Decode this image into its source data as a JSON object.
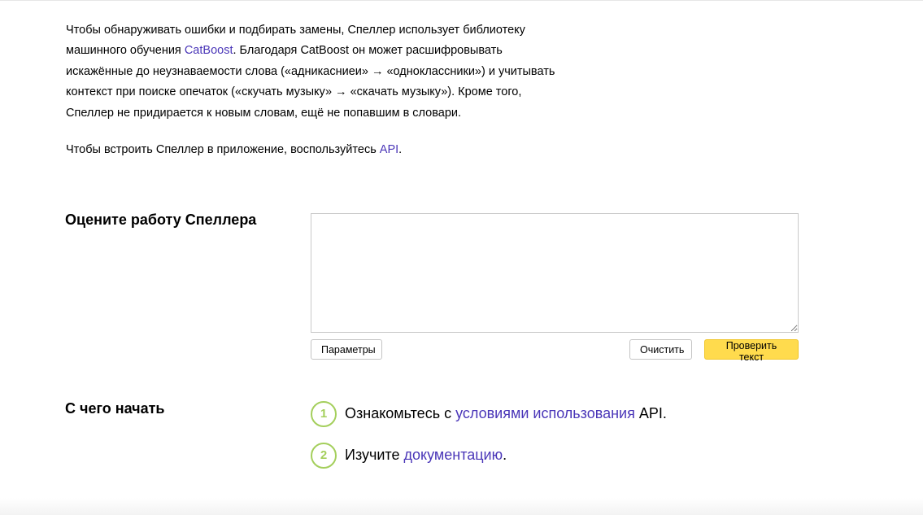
{
  "intro": {
    "p1_part1": "Чтобы обнаруживать ошибки и подбирать замены, Спеллер использует библиотеку машинного обучения ",
    "p1_link": "CatBoost",
    "p1_part2": ". Благодаря CatBoost он может расшифровывать искажённые до неузнаваемости слова («адникасниеи» → «одноклассники») и учитывать контекст при поиске опечаток («скучать музыку» → «скачать музыку»). Кроме того, Спеллер не придирается к новым словам, ещё не попавшим в словари.",
    "p2_part1": "Чтобы встроить Спеллер в приложение, воспользуйтесь ",
    "p2_link": "API",
    "p2_part2": "."
  },
  "rate": {
    "title": "Оцените работу Спеллера",
    "textarea_value": "",
    "params_label": "Параметры",
    "clear_label": "Очистить",
    "check_label": "Проверить текст"
  },
  "start": {
    "title": "С чего начать",
    "steps": [
      {
        "num": "1",
        "pre": "Ознакомьтесь с ",
        "link": "условиями использования",
        "post": " API."
      },
      {
        "num": "2",
        "pre": "Изучите ",
        "link": "документацию",
        "post": "."
      }
    ]
  },
  "colors": {
    "link": "#4a36b8",
    "primary_button": "#ffdb4d",
    "step_circle": "#a4cf5c"
  }
}
